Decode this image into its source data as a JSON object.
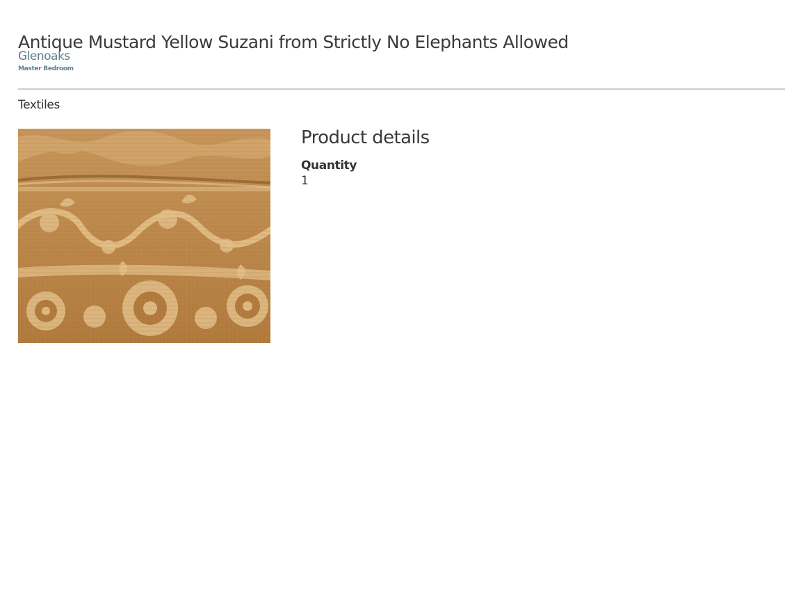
{
  "product": {
    "title": "Antique Mustard Yellow Suzani from Strictly No Elephants Allowed",
    "project": "Glenoaks",
    "room": "Master Bedroom",
    "category": "Textiles",
    "image_subject": "mustard-yellow-suzani-textile"
  },
  "details": {
    "heading": "Product details",
    "quantity_label": "Quantity",
    "quantity_value": "1"
  },
  "colors": {
    "link": "#5b7f8e",
    "divider": "#cccccc",
    "textile_base": "#b37d3f",
    "textile_pattern": "#e3c08a"
  }
}
